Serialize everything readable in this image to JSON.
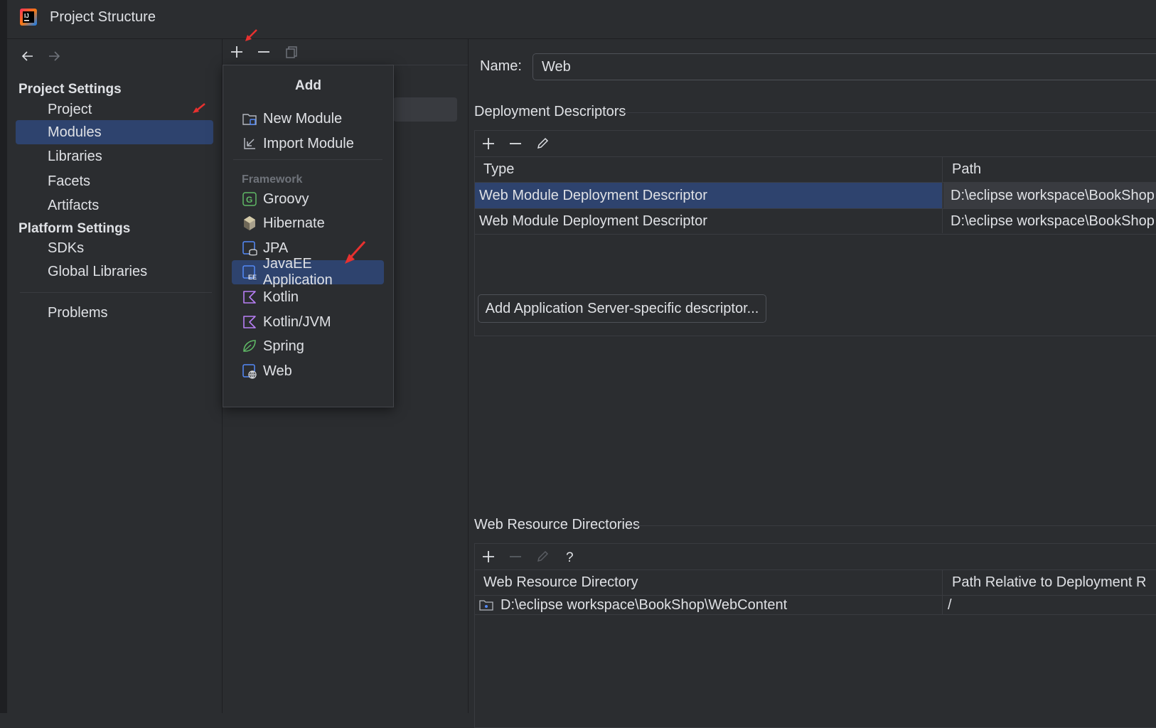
{
  "window": {
    "title": "Project Structure",
    "icon": "intellij-icon"
  },
  "nav": {
    "back_icon": "arrow-left-icon",
    "forward_icon": "arrow-right-icon",
    "project_settings_header": "Project Settings",
    "project_settings": [
      {
        "label": "Project",
        "selected": false
      },
      {
        "label": "Modules",
        "selected": true
      },
      {
        "label": "Libraries",
        "selected": false
      },
      {
        "label": "Facets",
        "selected": false
      },
      {
        "label": "Artifacts",
        "selected": false
      }
    ],
    "platform_settings_header": "Platform Settings",
    "platform_settings": [
      {
        "label": "SDKs"
      },
      {
        "label": "Global Libraries"
      }
    ],
    "problems": "Problems"
  },
  "middle_toolbar": [
    "plus-icon",
    "minus-icon",
    "copy-icon"
  ],
  "add_popup": {
    "title": "Add",
    "items": [
      {
        "label": "New Module",
        "icon": "new-module-icon"
      },
      {
        "label": "Import Module",
        "icon": "import-module-icon"
      }
    ],
    "framework_header": "Framework",
    "frameworks": [
      {
        "label": "Groovy",
        "icon": "groovy-icon"
      },
      {
        "label": "Hibernate",
        "icon": "hibernate-icon"
      },
      {
        "label": "JPA",
        "icon": "jpa-icon"
      },
      {
        "label": "JavaEE Application",
        "icon": "javaee-icon",
        "selected": true
      },
      {
        "label": "Kotlin",
        "icon": "kotlin-icon"
      },
      {
        "label": "Kotlin/JVM",
        "icon": "kotlin-jvm-icon"
      },
      {
        "label": "Spring",
        "icon": "spring-icon"
      },
      {
        "label": "Web",
        "icon": "web-icon"
      }
    ]
  },
  "details": {
    "name_label": "Name:",
    "name_value": "Web",
    "deployment": {
      "title": "Deployment Descriptors",
      "columns": [
        "Type",
        "Path"
      ],
      "rows": [
        {
          "type": "Web Module Deployment Descriptor",
          "path": "D:\\eclipse workspace\\BookShop",
          "selected": true
        },
        {
          "type": "Web Module Deployment Descriptor",
          "path": "D:\\eclipse workspace\\BookShop",
          "selected": false
        }
      ],
      "add_button": "Add Application Server-specific descriptor..."
    },
    "resources": {
      "title": "Web Resource Directories",
      "columns": [
        "Web Resource Directory",
        "Path Relative to Deployment R"
      ],
      "rows": [
        {
          "directory": "D:\\eclipse workspace\\BookShop\\WebContent",
          "relative": "/"
        }
      ]
    }
  },
  "colors": {
    "background": "#2b2d30",
    "selection": "#2e436e",
    "annotation_arrow": "#e8312f"
  }
}
